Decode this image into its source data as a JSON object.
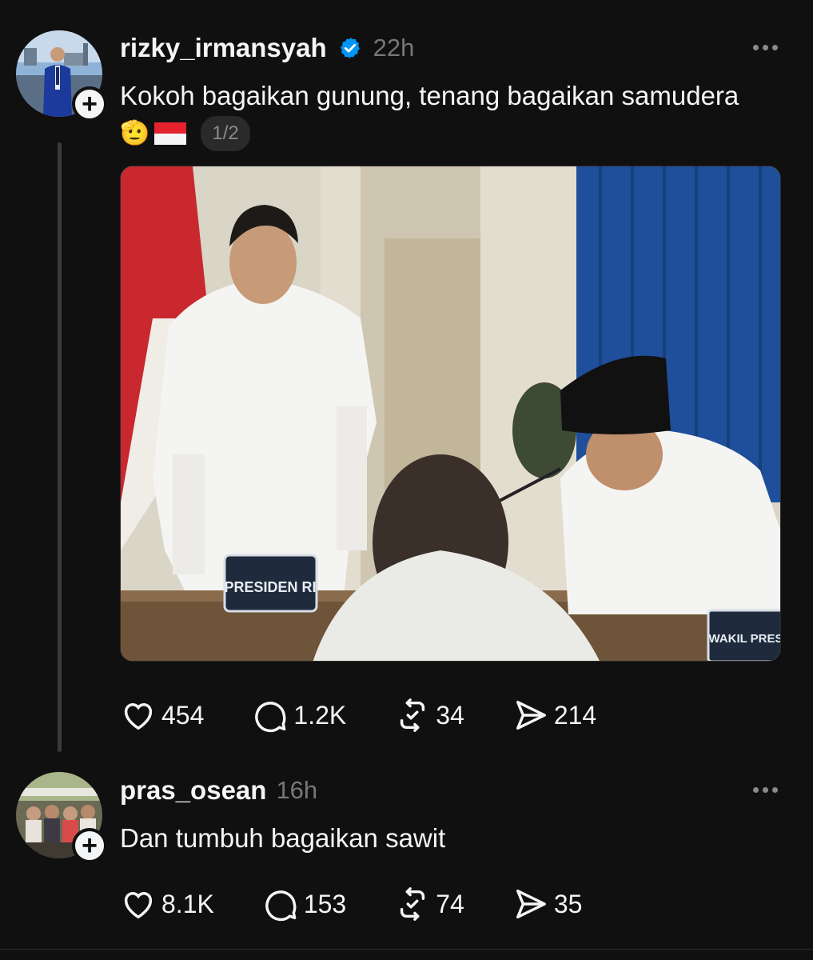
{
  "post1": {
    "username": "rizky_irmansyah",
    "time": "22h",
    "text": "Kokoh bagaikan gunung, tenang bagaikan samudera",
    "emojis": [
      "🫡",
      "🇮🇩"
    ],
    "media_counter": "1/2",
    "photo": {
      "placard_text": "PRESIDEN RI",
      "placard2_text": "WAKIL PRES"
    },
    "likes": "454",
    "replies": "1.2K",
    "reposts": "34",
    "shares": "214"
  },
  "post2": {
    "username": "pras_osean",
    "time": "16h",
    "text": "Dan tumbuh bagaikan sawit",
    "likes": "8.1K",
    "replies": "153",
    "reposts": "74",
    "shares": "35"
  },
  "colors": {
    "background": "#101010",
    "text": "#f3f5f7",
    "muted": "#777777",
    "verified": "#0095f6"
  },
  "icons": [
    "plus-icon",
    "verified-icon",
    "more-icon",
    "heart-icon",
    "comment-icon",
    "repost-icon",
    "share-icon"
  ]
}
